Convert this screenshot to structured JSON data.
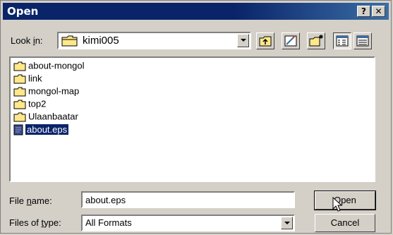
{
  "window": {
    "title": "Open"
  },
  "title_buttons": {
    "help": "?",
    "close": "✕"
  },
  "look_in": {
    "label_pre": "Look ",
    "label_key": "i",
    "label_post": "n:",
    "value": "kimi005",
    "icon": "folder-icon"
  },
  "toolbar": [
    {
      "name": "up-one-level-icon"
    },
    {
      "name": "desktop-icon"
    },
    {
      "name": "create-new-folder-icon"
    },
    {
      "name": "list-view-icon"
    },
    {
      "name": "details-view-icon"
    }
  ],
  "files": [
    {
      "name": "about-mongol",
      "type": "folder"
    },
    {
      "name": "link",
      "type": "folder"
    },
    {
      "name": "mongol-map",
      "type": "folder"
    },
    {
      "name": "top2",
      "type": "folder"
    },
    {
      "name": "Ulaanbaatar",
      "type": "folder"
    },
    {
      "name": "about.eps",
      "type": "file",
      "selected": true
    }
  ],
  "file_name": {
    "label_pre": "File ",
    "label_key": "n",
    "label_post": "ame:",
    "value": "about.eps"
  },
  "file_type": {
    "label_pre": "Files of ",
    "label_key": "t",
    "label_post": "ype:",
    "value": "All Formats"
  },
  "buttons": {
    "open_key": "O",
    "open_rest": "pen",
    "cancel": "Cancel"
  },
  "colors": {
    "title_bar": "#0a246a",
    "face": "#d4d0c8",
    "folder": "#ffe88a",
    "selection": "#0a246a"
  }
}
